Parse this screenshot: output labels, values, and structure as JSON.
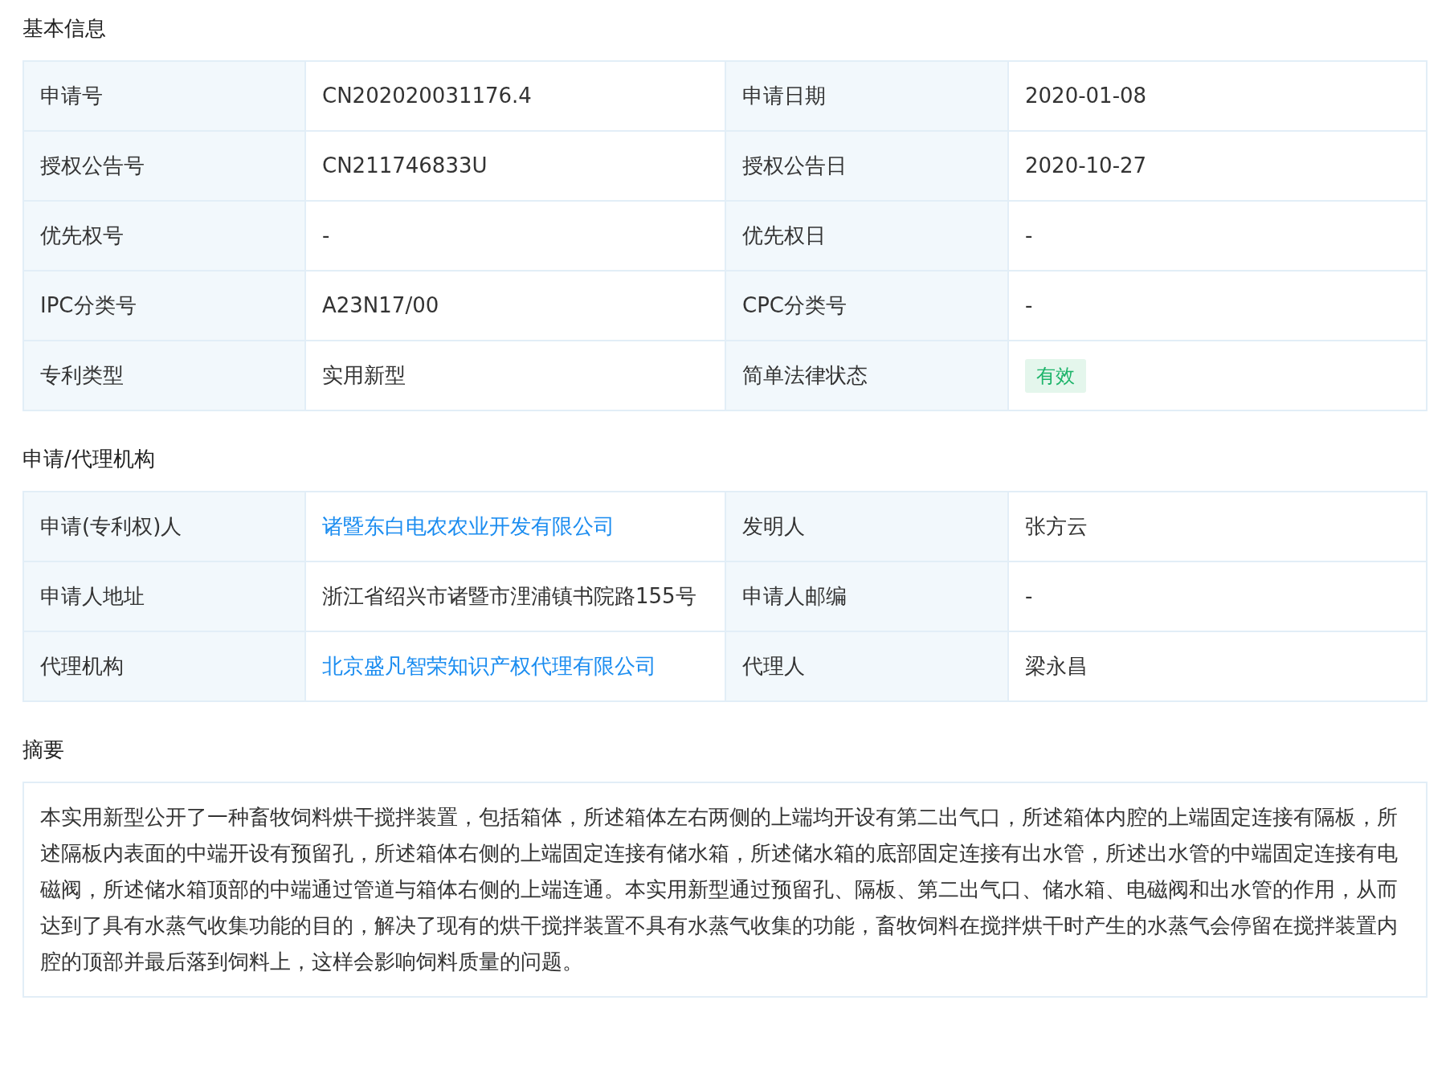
{
  "sections": [
    {
      "title": "基本信息",
      "kind": "table",
      "rows": [
        [
          {
            "label": "申请号",
            "value": "CN202020031176.4",
            "kind": "text"
          },
          {
            "label": "申请日期",
            "value": "2020-01-08",
            "kind": "text"
          }
        ],
        [
          {
            "label": "授权公告号",
            "value": "CN211746833U",
            "kind": "text"
          },
          {
            "label": "授权公告日",
            "value": "2020-10-27",
            "kind": "text"
          }
        ],
        [
          {
            "label": "优先权号",
            "value": "-",
            "kind": "text"
          },
          {
            "label": "优先权日",
            "value": "-",
            "kind": "text"
          }
        ],
        [
          {
            "label": "IPC分类号",
            "value": "A23N17/00",
            "kind": "text"
          },
          {
            "label": "CPC分类号",
            "value": "-",
            "kind": "text"
          }
        ],
        [
          {
            "label": "专利类型",
            "value": "实用新型",
            "kind": "text"
          },
          {
            "label": "简单法律状态",
            "value": "有效",
            "kind": "badge"
          }
        ]
      ]
    },
    {
      "title": "申请/代理机构",
      "kind": "table",
      "rows": [
        [
          {
            "label": "申请(专利权)人",
            "value": "诸暨东白电农农业开发有限公司",
            "kind": "link"
          },
          {
            "label": "发明人",
            "value": "张方云",
            "kind": "text"
          }
        ],
        [
          {
            "label": "申请人地址",
            "value": "浙江省绍兴市诸暨市浬浦镇书院路155号",
            "kind": "text"
          },
          {
            "label": "申请人邮编",
            "value": "-",
            "kind": "text"
          }
        ],
        [
          {
            "label": "代理机构",
            "value": "北京盛凡智荣知识产权代理有限公司",
            "kind": "link"
          },
          {
            "label": "代理人",
            "value": "梁永昌",
            "kind": "text"
          }
        ]
      ]
    },
    {
      "title": "摘要",
      "kind": "text",
      "text": "本实用新型公开了一种畜牧饲料烘干搅拌装置，包括箱体，所述箱体左右两侧的上端均开设有第二出气口，所述箱体内腔的上端固定连接有隔板，所述隔板内表面的中端开设有预留孔，所述箱体右侧的上端固定连接有储水箱，所述储水箱的底部固定连接有出水管，所述出水管的中端固定连接有电磁阀，所述储水箱顶部的中端通过管道与箱体右侧的上端连通。本实用新型通过预留孔、隔板、第二出气口、储水箱、电磁阀和出水管的作用，从而达到了具有水蒸气收集功能的目的，解决了现有的烘干搅拌装置不具有水蒸气收集的功能，畜牧饲料在搅拌烘干时产生的水蒸气会停留在搅拌装置内腔的顶部并最后落到饲料上，这样会影响饲料质量的问题。"
    }
  ]
}
